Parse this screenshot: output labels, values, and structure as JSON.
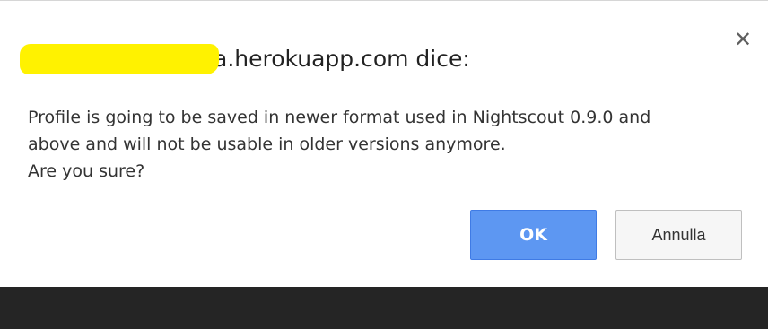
{
  "dialog": {
    "title": "a.herokuapp.com dice:",
    "close_icon": "✕",
    "message_lines": [
      "Profile is going to be saved in newer format used in Nightscout 0.9.0 and",
      "above and will not be usable in older versions anymore.",
      "Are you sure?"
    ],
    "ok_label": "OK",
    "cancel_label": "Annulla"
  },
  "colors": {
    "ok_button": "#5d97f2",
    "redaction": "#fff200",
    "background_band": "#252525"
  }
}
